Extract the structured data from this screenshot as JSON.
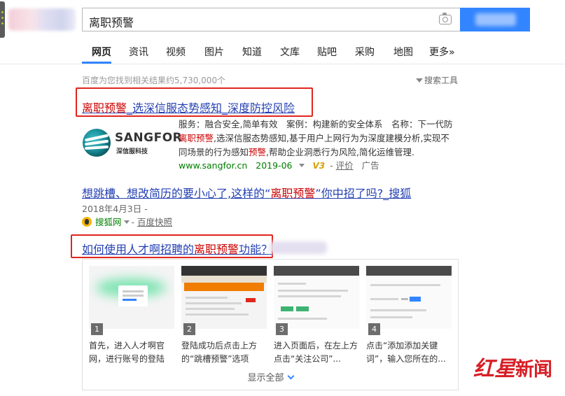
{
  "search": {
    "query": "离职预警"
  },
  "tabs": [
    {
      "label": "网页",
      "active": true
    },
    {
      "label": "资讯"
    },
    {
      "label": "视频"
    },
    {
      "label": "图片"
    },
    {
      "label": "知道"
    },
    {
      "label": "文库"
    },
    {
      "label": "贴吧"
    },
    {
      "label": "采购"
    },
    {
      "label": "地图"
    },
    {
      "label": "更多»"
    }
  ],
  "meta": {
    "result_count": "百度为您找到相关结果约5,730,000个",
    "tools_label": "搜索工具"
  },
  "result1": {
    "title_em": "离职预警",
    "title_rest": "_选深信服态势感知_深度防控风险",
    "logo_brand": "SANGFOR",
    "logo_cn": "深信服科技",
    "line1": "服务：融合安全,简单有效　案例：构建新的安全体系　名称：下一代防",
    "line2_em": "离职预警",
    "line2_rest": ",选深信服态势感知,基于用户上网行为为深度建模分析,实现不",
    "line3_a": "同场景的行为感知",
    "line3_em": "预警",
    "line3_b": ",帮助企业洞悉行为风险,简化运维管理.",
    "url": "www.sangfor.cn",
    "date": "2019-06",
    "badge": "V3",
    "review": "评价",
    "ad": "广告"
  },
  "result2": {
    "title_a": "想跳槽、想改简历的要小心了,这样的“",
    "title_em": "离职预警",
    "title_b": "”你中招了吗?_搜狐",
    "date": "2018年4月3日 -",
    "source": "搜狐网",
    "snapshot": "百度快照"
  },
  "result3": {
    "title_a": "如何使用人才啊招聘的",
    "title_em": "离职预警",
    "title_b": "功能？",
    "steps": [
      {
        "num": "1",
        "line1": "首先，进入人才啊官",
        "line2": "网，进行账号的登陆"
      },
      {
        "num": "2",
        "line1": "登陆成功后点击上方",
        "line2": "的“跳槽预警”选项"
      },
      {
        "num": "3",
        "line1": "进入页面后，在左上方",
        "line2": "点击“关注公司”..."
      },
      {
        "num": "4",
        "line1": "点击“添加添加关键",
        "line2": "词”，输入您所在的..."
      }
    ],
    "show_all": "显示全部"
  },
  "watermark": {
    "part1": "红星",
    "part2": "新闻"
  },
  "colors": {
    "link": "#2440b3",
    "emphasis": "#c00",
    "url_green": "#008000",
    "accent_blue": "#3385ff",
    "annotation_red": "#e0261e"
  }
}
